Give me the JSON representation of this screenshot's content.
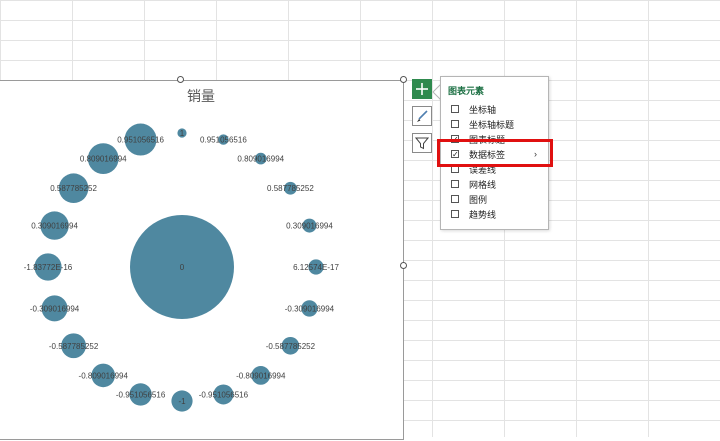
{
  "chart": {
    "title": "销量"
  },
  "chart_data": {
    "type": "scatter",
    "variant": "bubble",
    "title": "销量",
    "series_color": "#4f88a0",
    "points": [
      {
        "x": 0,
        "y": 0,
        "size": 0,
        "label": "0",
        "center": true
      },
      {
        "x": 0,
        "y": 1,
        "size": 1,
        "label": "1"
      },
      {
        "x": 0.309016994,
        "y": 0.951056516,
        "size": 2,
        "label": "0.951056516"
      },
      {
        "x": 0.587785252,
        "y": 0.809016994,
        "size": 3,
        "label": "0.809016994"
      },
      {
        "x": 0.809016994,
        "y": 0.587785252,
        "size": 4,
        "label": "0.587785252"
      },
      {
        "x": 0.951056516,
        "y": 0.309016994,
        "size": 5,
        "label": "0.309016994"
      },
      {
        "x": 1,
        "y": 0,
        "size": 6,
        "label": "6.12574E-17"
      },
      {
        "x": 0.951056516,
        "y": -0.309016994,
        "size": 7,
        "label": "-0.309016994"
      },
      {
        "x": 0.809016994,
        "y": -0.587785252,
        "size": 8,
        "label": "-0.587785252"
      },
      {
        "x": 0.587785252,
        "y": -0.809016994,
        "size": 9,
        "label": "-0.809016994"
      },
      {
        "x": 0.309016994,
        "y": -0.951056516,
        "size": 10,
        "label": "-0.951056516"
      },
      {
        "x": 0,
        "y": -1,
        "size": 11,
        "label": "-1"
      },
      {
        "x": -0.309016994,
        "y": -0.951056516,
        "size": 12,
        "label": "-0.951056516"
      },
      {
        "x": -0.587785252,
        "y": -0.809016994,
        "size": 13,
        "label": "-0.809016994"
      },
      {
        "x": -0.809016994,
        "y": -0.587785252,
        "size": 14,
        "label": "-0.587785252"
      },
      {
        "x": -0.951056516,
        "y": -0.309016994,
        "size": 15,
        "label": "-0.309016994"
      },
      {
        "x": -1,
        "y": 0,
        "size": 16,
        "label": "-1.83772E-16"
      },
      {
        "x": -0.951056516,
        "y": 0.309016994,
        "size": 17,
        "label": "0.309016994"
      },
      {
        "x": -0.809016994,
        "y": 0.587785252,
        "size": 18,
        "label": "0.587785252"
      },
      {
        "x": -0.587785252,
        "y": 0.809016994,
        "size": 19,
        "label": "0.809016994"
      },
      {
        "x": -0.309016994,
        "y": 0.951056516,
        "size": 20,
        "label": "0.951056516"
      }
    ],
    "data_labels": true
  },
  "side_buttons": [
    {
      "name": "chart-elements-button",
      "icon": "plus-icon",
      "active": true
    },
    {
      "name": "chart-styles-button",
      "icon": "brush-icon",
      "active": false
    },
    {
      "name": "chart-filters-button",
      "icon": "filter-icon",
      "active": false
    }
  ],
  "flyout": {
    "title": "图表元素",
    "items": [
      {
        "label": "坐标轴",
        "checked": false
      },
      {
        "label": "坐标轴标题",
        "checked": false
      },
      {
        "label": "图表标题",
        "checked": true
      },
      {
        "label": "数据标签",
        "checked": true,
        "has_submenu": true
      },
      {
        "label": "误差线",
        "checked": false
      },
      {
        "label": "网格线",
        "checked": false
      },
      {
        "label": "图例",
        "checked": false
      },
      {
        "label": "趋势线",
        "checked": false
      }
    ]
  },
  "highlight_color": "#e01010"
}
